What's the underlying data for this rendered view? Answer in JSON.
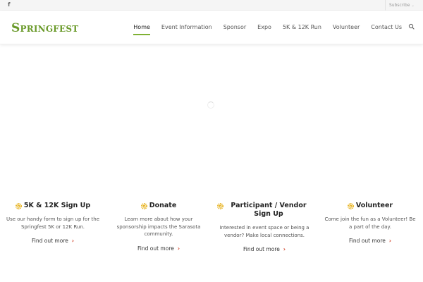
{
  "topbar": {
    "social_icon": "f",
    "subscribe_label": "Subscribe"
  },
  "header": {
    "logo_text": "Springfest",
    "nav": [
      {
        "label": "Home",
        "active": true
      },
      {
        "label": "Event Information",
        "active": false
      },
      {
        "label": "Sponsor",
        "active": false
      },
      {
        "label": "Expo",
        "active": false
      },
      {
        "label": "5K & 12K Run",
        "active": false
      },
      {
        "label": "Volunteer",
        "active": false
      },
      {
        "label": "Contact Us",
        "active": false
      }
    ]
  },
  "features": [
    {
      "title": "5K & 12K Sign Up",
      "description": "Use our handy form to sign up for the Springfest 5K or 12K Run.",
      "link": "Find out more"
    },
    {
      "title": "Donate",
      "description": "Learn more about how your sponsorship impacts the Sarasota community.",
      "link": "Find out more"
    },
    {
      "title": "Participant / Vendor Sign Up",
      "description": "Interested in event space or being a vendor? Make local connections.",
      "link": "Find out more"
    },
    {
      "title": "Volunteer",
      "description": "Come join the fun as a Volunteer! Be a part of the day.",
      "link": "Find out more"
    }
  ],
  "colors": {
    "accent_green": "#7fb134",
    "logo_green": "#6a9a2a",
    "arrow_red": "#d03a1f",
    "gear_yellow": "#e7b321"
  },
  "icons": {
    "social": "facebook-icon",
    "search": "search-icon",
    "feature": "gear-icon",
    "link_arrow": "chevron-right-icon"
  }
}
